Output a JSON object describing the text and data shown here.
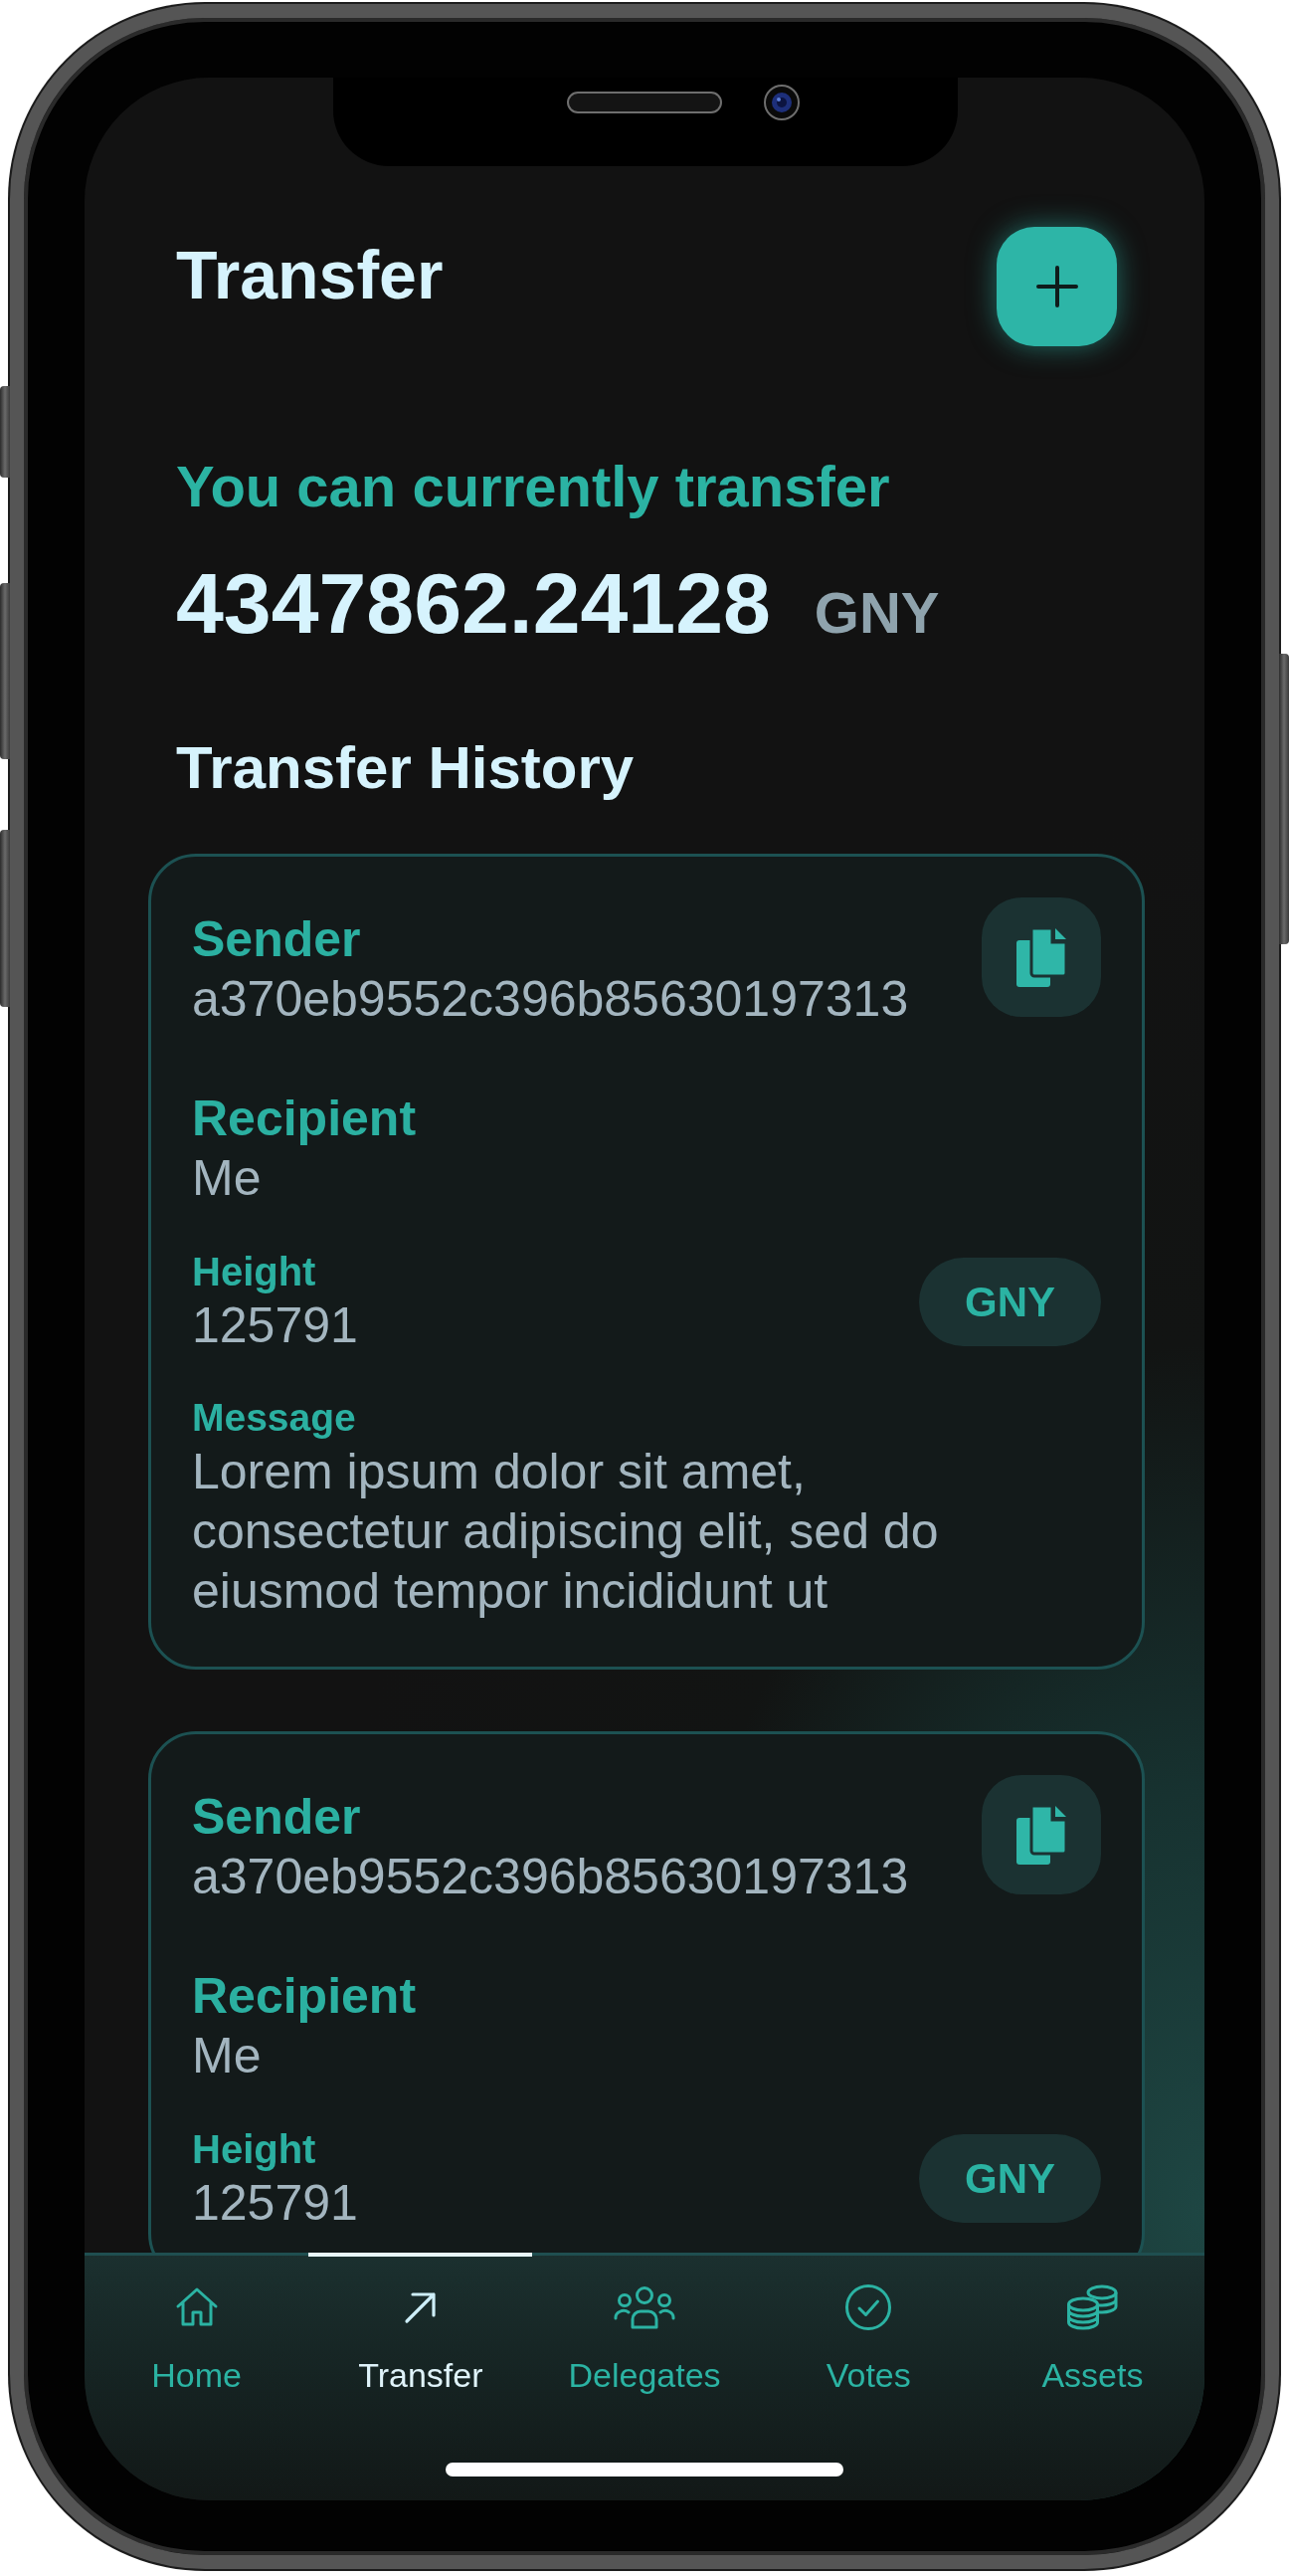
{
  "header": {
    "title": "Transfer"
  },
  "balance": {
    "caption": "You can currently transfer",
    "amount": "4347862.24128",
    "unit": "GNY"
  },
  "history": {
    "title": "Transfer History",
    "transfers": [
      {
        "sender": {
          "label": "Sender",
          "value": "a370eb9552c396b85630197313"
        },
        "recipient": {
          "label": "Recipient",
          "value": "Me"
        },
        "height": {
          "label": "Height",
          "value": "125791"
        },
        "token": "GNY",
        "message": {
          "label": "Message",
          "value": "Lorem ipsum dolor sit amet, consectetur adipiscing elit, sed do eiusmod tempor incididunt ut"
        }
      },
      {
        "sender": {
          "label": "Sender",
          "value": "a370eb9552c396b85630197313"
        },
        "recipient": {
          "label": "Recipient",
          "value": "Me"
        },
        "height": {
          "label": "Height",
          "value": "125791"
        },
        "token": "GNY"
      }
    ]
  },
  "tab_bar": {
    "tabs": [
      {
        "label": "Home",
        "selected": false
      },
      {
        "label": "Transfer",
        "selected": true
      },
      {
        "label": "Delegates",
        "selected": false
      },
      {
        "label": "Votes",
        "selected": false
      },
      {
        "label": "Assets",
        "selected": false
      }
    ]
  }
}
